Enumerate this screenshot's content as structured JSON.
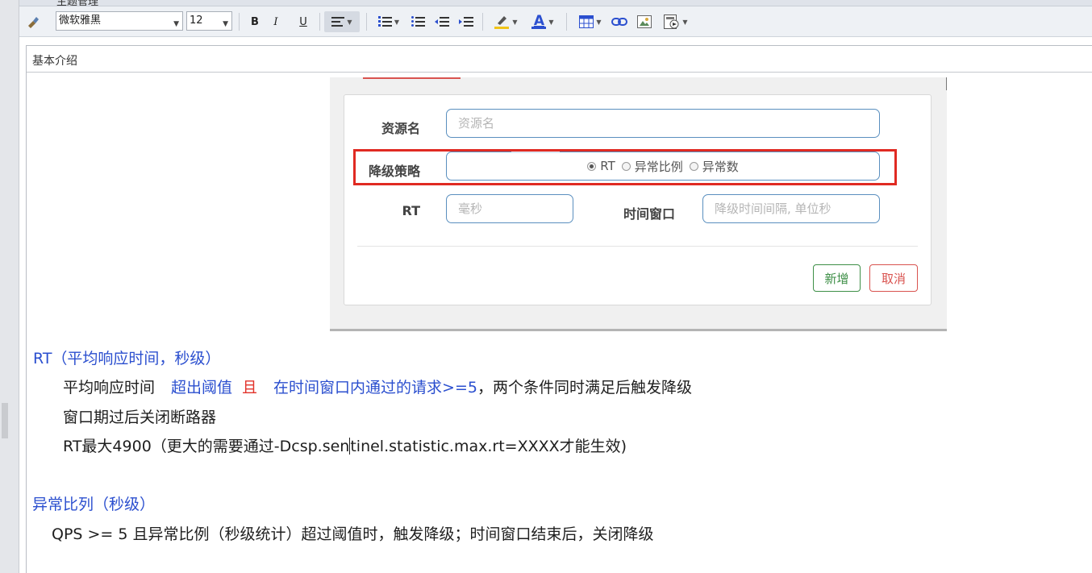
{
  "window": {
    "title": "主题管理"
  },
  "toolbar": {
    "font_family": "微软雅黑",
    "font_size": "12",
    "bold": "B",
    "italic": "I",
    "underline": "U",
    "font_color_letter": "A"
  },
  "document": {
    "section_heading": "基本介绍",
    "dialog": {
      "resource_label": "资源名",
      "resource_placeholder": "资源名",
      "strategy_label": "降级策略",
      "options": [
        "RT",
        "异常比例",
        "异常数"
      ],
      "selected_option": "RT",
      "rt_label": "RT",
      "rt_placeholder": "毫秒",
      "window_label": "时间窗口",
      "window_placeholder": "降级时间间隔, 单位秒",
      "add_button": "新增",
      "cancel_button": "取消"
    },
    "rt_title": "RT（平均响应时间，秒级）",
    "rt_line1": {
      "a": "平均响应时间",
      "b": "超出阈值",
      "c": "且",
      "d": "在时间窗口内通过的请求>=5",
      "e": "，两个条件同时满足后触发降级"
    },
    "rt_line2": "窗口期过后关闭断路器",
    "rt_line3_a": "RT最大4900（更大的需要通过-Dcsp.sen",
    "rt_line3_b": "tinel.statistic.max.rt=XXXX才能生效)",
    "ratio_title": "异常比列（秒级）",
    "ratio_line": "QPS >= 5 且异常比例（秒级统计）超过阈值时，触发降级；时间窗口结束后，关闭降级"
  },
  "colors": {
    "highlight_box": "#e02a22",
    "blue_text": "#2b4fcf",
    "red_text": "#e2332b",
    "add_button": "#3e8f47",
    "cancel_button": "#d9534f"
  }
}
